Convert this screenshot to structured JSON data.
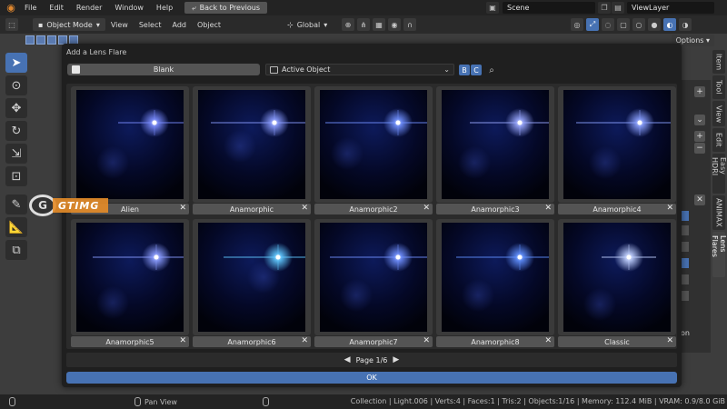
{
  "menubar": {
    "items": [
      "File",
      "Edit",
      "Render",
      "Window",
      "Help"
    ],
    "back_button": "Back to Previous",
    "scene": "Scene",
    "view_layer": "ViewLayer"
  },
  "toolbar": {
    "mode": "Object Mode",
    "menus": [
      "View",
      "Select",
      "Add",
      "Object"
    ],
    "transform_orientation": "Global",
    "options": "Options"
  },
  "side_tabs": [
    "Item",
    "Tool",
    "View",
    "Edit",
    "Easy HDRI",
    "ANIMAX",
    "Lens Flares"
  ],
  "side_panel_text": "on",
  "dialog": {
    "title": "Add a Lens Flare",
    "blank_label": "Blank",
    "object_selector": "Active Object",
    "toggle_b": "B",
    "toggle_c": "C",
    "close_glyph": "✕",
    "flares": [
      {
        "label": "Alien"
      },
      {
        "label": "Anamorphic"
      },
      {
        "label": "Anamorphic2"
      },
      {
        "label": "Anamorphic3"
      },
      {
        "label": "Anamorphic4"
      },
      {
        "label": "Anamorphic5"
      },
      {
        "label": "Anamorphic6"
      },
      {
        "label": "Anamorphic7"
      },
      {
        "label": "Anamorphic8"
      },
      {
        "label": "Classic"
      }
    ],
    "page": "Page 1/6",
    "ok_label": "OK"
  },
  "watermark": {
    "text": "GTIMG"
  },
  "statusbar": {
    "hint": "Pan View",
    "stats": "Collection | Light.006 | Verts:4 | Faces:1 | Tris:2 | Objects:1/16 | Memory: 112.4 MiB | VRAM: 0.9/8.0 GiB"
  },
  "colors": {
    "accent": "#4772b3",
    "watermark": "#e68c28"
  },
  "icons": [
    "blender-logo-icon",
    "back-arrow-icon",
    "scene-icon",
    "viewlayer-icon",
    "search-icon",
    "cursor-icon",
    "move-icon",
    "rotate-icon",
    "scale-icon",
    "transform-icon",
    "annotate-icon",
    "measure-icon",
    "add-cube-icon",
    "page-prev-icon",
    "page-next-icon",
    "mouse-icon"
  ]
}
